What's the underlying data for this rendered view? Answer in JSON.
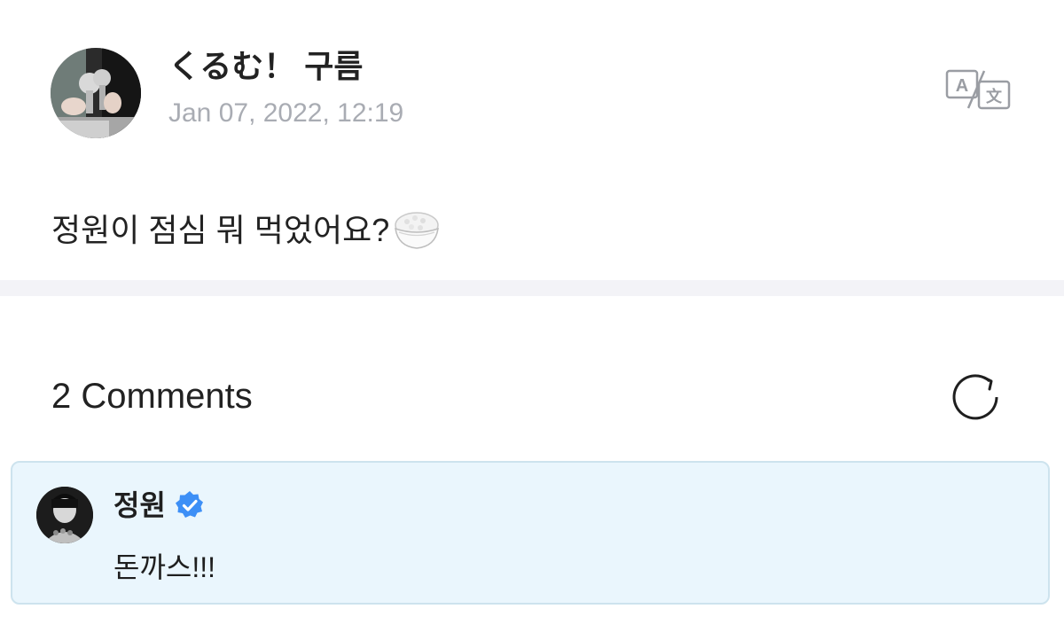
{
  "post": {
    "author": "くるむ！ 구름",
    "date": "Jan 07, 2022, 12:19",
    "text": "정원이 점심 뭐 먹었어요?",
    "emoji_icon": "rice-bowl-icon",
    "translate_icon": "translate-icon"
  },
  "comments": {
    "count_label": "2 Comments",
    "refresh_icon": "refresh-icon",
    "items": [
      {
        "author": "정원",
        "verified": true,
        "text": "돈까스!!!"
      }
    ]
  },
  "colors": {
    "comment_bg": "#eaf6fd",
    "comment_border": "#cde3ee",
    "verified_blue": "#3d8ff6",
    "date_gray": "#a9acb3",
    "divider": "#f3f3f7"
  }
}
